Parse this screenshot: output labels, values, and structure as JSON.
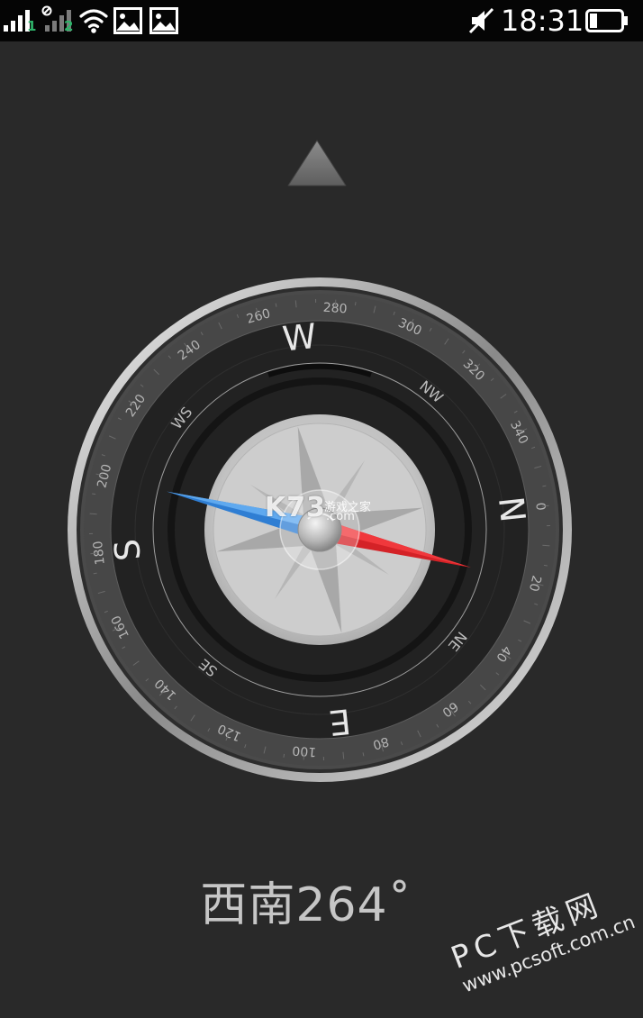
{
  "status_bar": {
    "time": "18:31",
    "sim1": "1",
    "sim2": "2",
    "icons": [
      "signal-bars-icon",
      "signal-bars-icon",
      "wifi-icon",
      "image-icon",
      "image-icon",
      "mute-icon",
      "battery-icon"
    ]
  },
  "compass": {
    "heading_degrees": 264,
    "heading_text": "西南264˚",
    "cardinals": [
      "N",
      "W",
      "S",
      "E"
    ],
    "intercardinals": [
      "NW",
      "WS",
      "SE",
      "NE"
    ],
    "degree_labels": [
      "0",
      "20",
      "40",
      "60",
      "80",
      "100",
      "120",
      "140",
      "160",
      "180",
      "200",
      "220",
      "240",
      "260",
      "280",
      "300",
      "320",
      "340"
    ],
    "needle_colors": {
      "north": "#e3262a",
      "south": "#3c8fe0"
    }
  },
  "watermarks": {
    "k73_logo": "K73",
    "k73_cn": "游戏之家",
    "k73_domain": ".com",
    "pc_brand": "PC下载网",
    "pc_url": "www.pcsoft.com.cn"
  }
}
